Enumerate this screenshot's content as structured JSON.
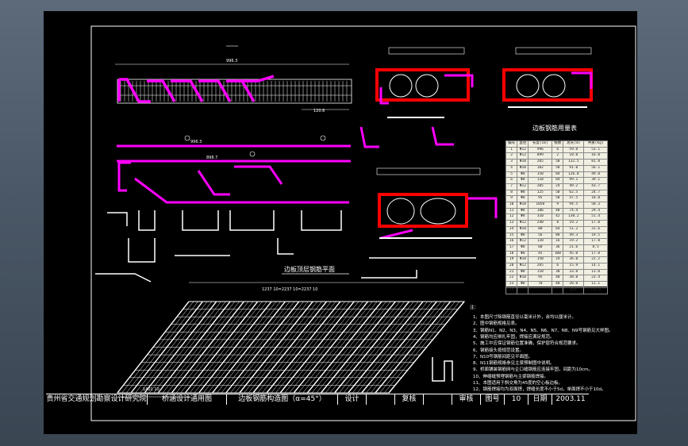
{
  "drawing": {
    "plan_title": "边板顶层钢筋平面",
    "table_title": "边板钢筋用量表",
    "notes_heading": "注：",
    "notes": [
      "1、本图尺寸除钢筋直径以毫米计外，余均以厘米计。",
      "2、图中钢筋规格见表。",
      "3、钢筋N1、N2、N3、N4、N5、N6、N7、N8、N9号钢筋见大样图。",
      "4、钢筋均应绑扎牢固，焊接应满足规范。",
      "5、施工中应保证钢筋位置准确，保护层符合规范要求。",
      "6、钢筋接头按规范设置。",
      "7、N10号钢筋间距见平面图。",
      "8、N11钢筋规格参见主梁预制图中说明。",
      "9、桥面铺装钢筋网与企口缝钢筋应连接牢固，间距为10cm。",
      "10、伸缩缝预埋钢筋与主梁钢筋焊接。",
      "11、本图适用于斜交角为45度的空心板边板。",
      "12、钢筋焊接均为双面焊，焊缝长度不小于5d，单面焊不小于10d。"
    ],
    "dimension_labels": {
      "top_total": "996.3",
      "side_dim": "120.6",
      "n1_long": "996.3",
      "n2_long": "898.7",
      "plan_top": "1237 10=2237 10=2237 10",
      "plan_bottom": "1401 10"
    }
  },
  "table": {
    "headers": [
      "编号",
      "直径",
      "长度(cm)",
      "根数",
      "总长(m)",
      "共重(kg)"
    ],
    "rows": [
      [
        "1",
        "Φ12",
        "996",
        "6",
        "59.8",
        "53.1"
      ],
      [
        "2",
        "Φ12",
        "899",
        "2",
        "18.0",
        "16.0"
      ],
      [
        "3",
        "Φ10",
        "265",
        "50",
        "132.5",
        "81.8"
      ],
      [
        "4",
        "Φ10",
        "182",
        "50",
        "91.0",
        "56.1"
      ],
      [
        "5",
        "Φ8",
        "150",
        "84",
        "126.0",
        "49.8"
      ],
      [
        "6",
        "Φ8",
        "118",
        "84",
        "99.1",
        "39.1"
      ],
      [
        "7",
        "Φ12",
        "205",
        "24",
        "49.2",
        "43.7"
      ],
      [
        "8",
        "Φ8",
        "125",
        "50",
        "62.5",
        "24.7"
      ],
      [
        "9",
        "Φ8",
        "95",
        "50",
        "47.5",
        "18.8"
      ],
      [
        "10",
        "Φ10",
        "1050",
        "9",
        "94.5",
        "58.3"
      ],
      [
        "11",
        "Φ8",
        "186",
        "40",
        "74.4",
        "29.4"
      ],
      [
        "12",
        "Φ8",
        "310",
        "42",
        "130.2",
        "51.4"
      ],
      [
        "13",
        "Φ12",
        "240",
        "8",
        "19.2",
        "17.0"
      ],
      [
        "14",
        "Φ10",
        "80",
        "64",
        "51.2",
        "31.6"
      ],
      [
        "15",
        "Φ8",
        "56",
        "88",
        "49.3",
        "19.5"
      ],
      [
        "16",
        "Φ12",
        "120",
        "16",
        "19.2",
        "17.0"
      ],
      [
        "17",
        "Φ8",
        "60",
        "36",
        "21.6",
        "8.5"
      ],
      [
        "18",
        "Φ8",
        "45",
        "100",
        "45.0",
        "17.8"
      ],
      [
        "19",
        "Φ10",
        "150",
        "24",
        "36.0",
        "22.2"
      ],
      [
        "20",
        "Φ12",
        "265",
        "6",
        "15.9",
        "14.1"
      ],
      [
        "21",
        "Φ8",
        "110",
        "30",
        "33.0",
        "13.0"
      ],
      [
        "22",
        "Φ10",
        "95",
        "40",
        "38.0",
        "23.4"
      ],
      [
        "23",
        "Φ8",
        "70",
        "40",
        "28.0",
        "11.1"
      ],
      [
        "24",
        "",
        "",
        "",
        "合计",
        "733.4"
      ]
    ]
  },
  "title_block": {
    "org": "贵州省交通规划勘察设计研究院",
    "doc": "桥涵设计通用图",
    "sheet_title": "边板钢筋构造图（α=45°）",
    "design_label": "设计",
    "review_label": "复核",
    "check_label": "审核",
    "drawing_no_label": "图号",
    "drawing_no": "10",
    "date_label": "日期",
    "date": "2003.11"
  },
  "colors": {
    "background_ui": "#4a5766",
    "sheet": "#000000",
    "rebar_main": "#ff00ff",
    "rebar_section": "#ff0000",
    "line": "#ffffff"
  }
}
